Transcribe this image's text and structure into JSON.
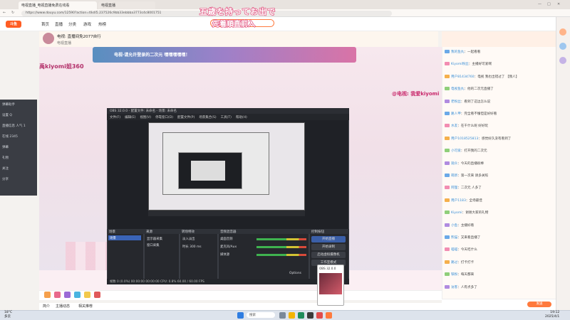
{
  "browser": {
    "tabs": [
      "电视直播_电视直播免费在线看",
      "电视直播"
    ],
    "url": "https://www.douyu.com/12590?action=tlkdl5.237526c9bb33ebbba3773c4c8001751"
  },
  "overlay": {
    "caption_top": "五歳を持ってお出で",
    "caption_sub": "先着順直前入"
  },
  "site": {
    "logo": "斗鱼",
    "nav": [
      "首页",
      "直播",
      "分类",
      "游戏",
      "热榜"
    ],
    "search_placeholder": ""
  },
  "room": {
    "title": "电视: 直播间免2077自行",
    "streamer": "电视直播",
    "banner": "电视·请允许登录的二次元 嘿嘿嘿嘿嘿！",
    "overlay_name": "禹kiyomi姐360",
    "right_name": "@电视: 我爱kiyomi"
  },
  "bottom_tabs": [
    "简介",
    "主播动态",
    "相关推荐"
  ],
  "chat": {
    "lines": [
      {
        "user": "我的鱼丸",
        "text": "一起看看"
      },
      {
        "user": "Kiyomi粉丝",
        "text": "主播好可爱啊"
      },
      {
        "user": "用户81434760",
        "text": "电视 我也出错过了 【我人】"
      },
      {
        "user": "电视鱼丸",
        "text": "他的二次元直播了"
      },
      {
        "user": "老粉丝",
        "text": "看到了这边怎么说"
      },
      {
        "user": "路人甲",
        "text": "完全看不懂但是好好看"
      },
      {
        "user": "水友",
        "text": "在干什么呢 好好玩"
      },
      {
        "user": "用户1018525813",
        "text": "感觉好久没有看到了"
      },
      {
        "user": "小可爱",
        "text": "打开我的二次元"
      },
      {
        "user": "观众",
        "text": "今天的直播很棒"
      },
      {
        "user": "萌新",
        "text": "第一次来 请多关照"
      },
      {
        "user": "阿狸",
        "text": "二次元 人多了"
      },
      {
        "user": "用户1183",
        "text": "全场最佳"
      },
      {
        "user": "Kiyomi",
        "text": "谢谢大家的礼物"
      },
      {
        "user": "小鱼",
        "text": "主播好看"
      },
      {
        "user": "熊猫",
        "text": "又来看直播了"
      },
      {
        "user": "喵喵",
        "text": "今天吃什么"
      },
      {
        "user": "路过",
        "text": "打卡打卡"
      },
      {
        "user": "铁粉",
        "text": "每天都来"
      },
      {
        "user": "访客",
        "text": "人有点多了"
      }
    ],
    "send": "发送"
  },
  "left_panel": {
    "lines": [
      "弹幕助手",
      "设置 Q",
      "直播信息 人气 1",
      "在线 2345",
      "弹幕",
      "礼物",
      "关注",
      "分享"
    ]
  },
  "obs": {
    "title": "OBS 32.0.0 - 配置文件: 未命名 - 场景: 未命名",
    "menu": [
      "文件(F)",
      "编辑(E)",
      "视图(V)",
      "停靠窗口(D)",
      "配置文件(P)",
      "场景集合(S)",
      "工具(T)",
      "帮助(H)"
    ],
    "docks": {
      "scenes": "场景",
      "scene_item": "场景",
      "sources": "来源",
      "source_items": [
        "显示器采集",
        "窗口采集"
      ],
      "mixer": "音频混音器",
      "mixer_items": [
        "桌面音频",
        "麦克风/Aux",
        "媒体源"
      ],
      "transitions": "转场特效",
      "transition_items": [
        "淡入淡出",
        "时长 300 ms"
      ],
      "controls": "控制按钮",
      "control_items": [
        "开始直播",
        "开始录制",
        "启动虚拟摄像机",
        "工作室模式",
        "设置",
        "退出"
      ]
    },
    "status": "帧数 0 (0.0%)    00:00:00    00:00:00    CPU: 0.8%    60.00 / 60.00 FPS",
    "options_label": "Options"
  },
  "thumb": {
    "title": "OBS 32.0.0"
  },
  "taskbar": {
    "weather_temp": "18°C",
    "weather_desc": "多云",
    "search": "搜索",
    "time": "19:12",
    "date": "2025/4/1"
  },
  "colors": {
    "accent": "#ff7a3d",
    "obs_bg": "#1f2126",
    "obs_accent": "#3b5fa8"
  }
}
